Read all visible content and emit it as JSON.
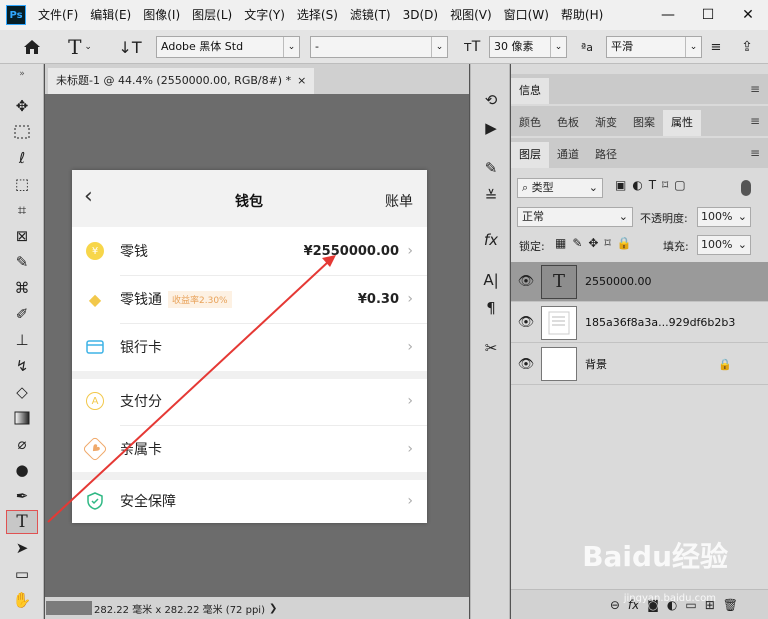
{
  "app": {
    "logo": "Ps"
  },
  "menu": [
    "文件(F)",
    "编辑(E)",
    "图像(I)",
    "图层(L)",
    "文字(Y)",
    "选择(S)",
    "滤镜(T)",
    "3D(D)",
    "视图(V)",
    "窗口(W)",
    "帮助(H)"
  ],
  "window": {
    "min": "—",
    "max": "☐",
    "close": "✕"
  },
  "options": {
    "font_family": "Adobe 黑体 Std",
    "font_style": "-",
    "font_size": "30 像素",
    "aa_label": "ªa",
    "antialias": "平滑"
  },
  "document": {
    "tab_title": "未标题-1 @ 44.4% (2550000.00, RGB/8#) *",
    "close": "×",
    "status": "282.22 毫米 x 282.22 毫米 (72 ppi)",
    "status_arrow": "❯"
  },
  "panels": {
    "group1": [
      "信息"
    ],
    "group2": [
      "颜色",
      "色板",
      "渐变",
      "图案",
      "属性"
    ],
    "group3": [
      "图层",
      "通道",
      "路径"
    ],
    "filter_kind": "类型",
    "blend_mode": "正常",
    "opacity_label": "不透明度:",
    "opacity": "100%",
    "lock_label": "锁定:",
    "fill_label": "填充:",
    "fill": "100%",
    "layers": [
      {
        "name": "2550000.00",
        "thumb": "T"
      },
      {
        "name": "185a36f8a3a...929df6b2b3",
        "thumb": ""
      },
      {
        "name": "背景",
        "thumb": ""
      }
    ]
  },
  "phone": {
    "back": "‹",
    "title": "钱包",
    "bill": "账单",
    "rows": [
      {
        "label": "零钱",
        "value": "¥2550000.00"
      },
      {
        "label": "零钱通",
        "badge": "收益率2.30%",
        "value": "¥0.30"
      },
      {
        "label": "银行卡",
        "value": ""
      },
      {
        "label": "支付分",
        "value": ""
      },
      {
        "label": "亲属卡",
        "value": ""
      },
      {
        "label": "安全保障",
        "value": ""
      }
    ],
    "chevron": "›"
  },
  "watermark": {
    "brand": "Baidu经验",
    "url": "jingyan.baidu.com"
  },
  "colors": {
    "arrow": "#e53935",
    "ps_blue": "#31a8ff",
    "badge": "#e8a259"
  }
}
